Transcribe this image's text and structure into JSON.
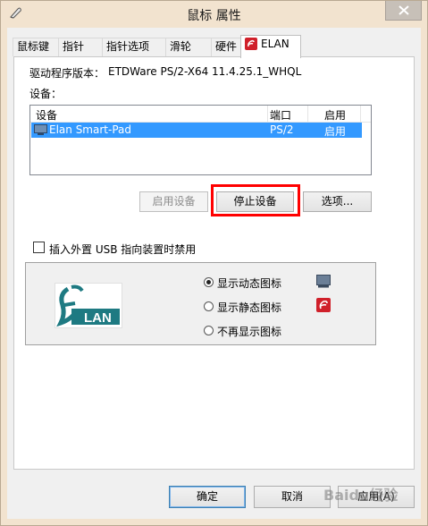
{
  "window": {
    "title": "鼠标 属性",
    "icon": "mouse-icon",
    "close_icon": "close-icon"
  },
  "tabs": [
    {
      "label": "鼠标键",
      "active": false
    },
    {
      "label": "指针",
      "active": false
    },
    {
      "label": "指针选项",
      "active": false
    },
    {
      "label": "滑轮",
      "active": false
    },
    {
      "label": "硬件",
      "active": false
    },
    {
      "label": "ELAN",
      "active": true,
      "icon": "elan-icon"
    }
  ],
  "elan": {
    "driver_version_label": "驱动程序版本：",
    "driver_version_value": "ETDWare PS/2-X64 11.4.25.1_WHQL",
    "devices_label": "设备：",
    "device_table": {
      "columns": [
        "设备",
        "端口",
        "启用"
      ],
      "rows": [
        {
          "device": "Elan Smart-Pad",
          "port": "PS/2",
          "enabled": "启用",
          "selected": true
        }
      ]
    },
    "buttons": {
      "enable": "启用设备",
      "disable": "停止设备",
      "options": "选项..."
    },
    "usb_checkbox_label": "插入外置 USB 指向装置时禁用",
    "usb_checkbox_checked": false,
    "icon_options": [
      {
        "label": "显示动态图标",
        "selected": true,
        "icon": "monitor-icon"
      },
      {
        "label": "显示静态图标",
        "selected": false,
        "icon": "elan-icon"
      },
      {
        "label": "不再显示图标",
        "selected": false
      }
    ],
    "logo_text": "LAN",
    "logo_letter": "E"
  },
  "footer": {
    "ok": "确定",
    "cancel": "取消",
    "apply": "应用(A)"
  },
  "watermark": "Baidu经验",
  "colors": {
    "selection": "#3399ff",
    "highlight_box": "#ff0000",
    "elan_red": "#d0202a",
    "elan_teal": "#1e7a82"
  }
}
